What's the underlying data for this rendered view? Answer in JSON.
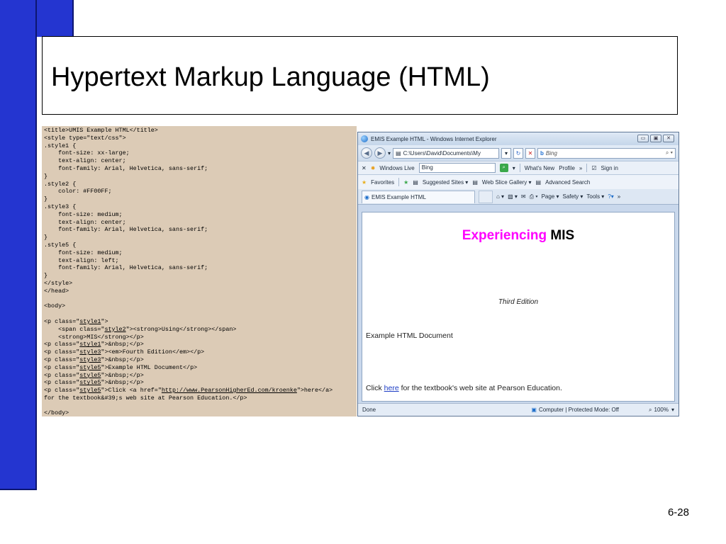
{
  "slide": {
    "title": "Hypertext Markup Language (HTML)",
    "page_number": "6-28"
  },
  "code_lines": [
    [
      "<title>UMIS Example HTML</title>"
    ],
    [
      "<style type=\"text/css\">"
    ],
    [
      ".style1 {"
    ],
    [
      "    font-size: xx-large;"
    ],
    [
      "    text-align: center;"
    ],
    [
      "    font-family: Arial, Helvetica, sans-serif;"
    ],
    [
      "}"
    ],
    [
      ".style2 {"
    ],
    [
      "    color: #FF00FF;"
    ],
    [
      "}"
    ],
    [
      ".style3 {"
    ],
    [
      "    font-size: medium;"
    ],
    [
      "    text-align: center;"
    ],
    [
      "    font-family: Arial, Helvetica, sans-serif;"
    ],
    [
      "}"
    ],
    [
      ".style5 {"
    ],
    [
      "    font-size: medium;"
    ],
    [
      "    text-align: left;"
    ],
    [
      "    font-family: Arial, Helvetica, sans-serif;"
    ],
    [
      "}"
    ],
    [
      "</style>"
    ],
    [
      "</head>"
    ],
    [
      ""
    ],
    [
      "<body>"
    ],
    [
      ""
    ],
    [
      "<p class=\"",
      "_style1",
      "\">"
    ],
    [
      "    <span class=\"",
      "_style2",
      "\"><strong>Using</strong></span>"
    ],
    [
      "    <strong>MIS</strong></p>"
    ],
    [
      "<p class=\"",
      "_style1",
      "\">&nbsp;</p>"
    ],
    [
      "<p class=\"",
      "_style3",
      "\"><em>Fourth Edition</em></p>"
    ],
    [
      "<p class=\"",
      "_style3",
      "\">&nbsp;</p>"
    ],
    [
      "<p class=\"",
      "_style5",
      "\">Example HTML Document</p>"
    ],
    [
      "<p class=\"",
      "_style5",
      "\">&nbsp;</p>"
    ],
    [
      "<p class=\"",
      "_style5",
      "\">&nbsp;</p>"
    ],
    [
      "<p class=\"",
      "_style5",
      "\">Click <a href=\"",
      "_http://www.PearsonHigherEd.com/kroenke",
      "\">here</a>"
    ],
    [
      "for the textbook&#39;s web site at Pearson Education.</p>"
    ],
    [
      ""
    ],
    [
      "</body>"
    ]
  ],
  "browser": {
    "window_title": "EMIS Example HTML - Windows Internet Explorer",
    "address": "C:\\Users\\David\\Documents\\My",
    "search_placeholder": "Bing",
    "links_bar": {
      "close": "✕",
      "windows_live": "Windows Live",
      "bing_value": "Bing",
      "whats_new": "What's New",
      "profile": "Profile",
      "more": "»",
      "sign_in": "Sign in"
    },
    "favorites_bar": {
      "favorites": "Favorites",
      "suggested_sites": "Suggested Sites ▾",
      "web_slice_gallery": "Web Slice Gallery ▾",
      "advanced_search": "Advanced Search"
    },
    "tab_title": "EMIS Example HTML",
    "command_bar": {
      "page": "Page ▾",
      "safety": "Safety ▾",
      "tools": "Tools ▾",
      "more": "»"
    },
    "content": {
      "title_pink": "Experiencing",
      "title_black": "MIS",
      "edition": "Third Edition",
      "example": "Example HTML Document",
      "click_prefix": "Click ",
      "click_link": "here",
      "click_suffix": " for the textbook's web site at Pearson Education."
    },
    "status": {
      "done": "Done",
      "zone": "Computer | Protected Mode: Off",
      "zoom": "100%"
    }
  },
  "colors": {
    "accent_bar": "#2435d0",
    "code_background": "#dccbb6",
    "pink_text": "#ff00ff"
  }
}
